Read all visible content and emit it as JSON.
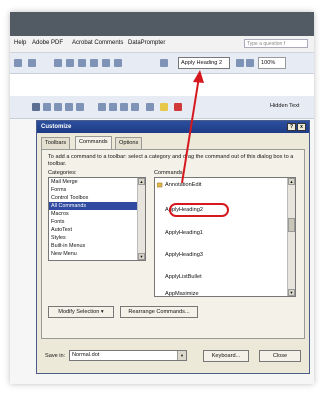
{
  "menubar": {
    "items": [
      "Help",
      "Adobe PDF",
      "Acrobat Comments",
      "DataPrompter"
    ],
    "ask_placeholder": "Type a question f"
  },
  "toolbar": {
    "style_value": "Apply Heading 2",
    "zoom_value": "100%",
    "hidden_text": "Hidden Text"
  },
  "dialog": {
    "title": "Customize",
    "close_glyph": "x",
    "help_glyph": "?",
    "tabs": [
      "Toolbars",
      "Commands",
      "Options"
    ],
    "active_tab": "Commands",
    "instructions": "To add a command to a toolbar: select a category and drag the command out of this dialog box to a toolbar.",
    "categories_label": "Categories:",
    "commands_label": "Commands:",
    "categories": [
      "Mail Merge",
      "Forms",
      "Control Toolbox",
      "All Commands",
      "Macros",
      "Fonts",
      "AutoText",
      "Styles",
      "Built-in Menus",
      "New Menu"
    ],
    "selected_category": "All Commands",
    "commands": [
      "AnnotationEdit",
      "ApplyHeading2",
      "ApplyHeading1",
      "ApplyHeading3",
      "ApplyListBullet",
      "AppMaximize"
    ],
    "highlighted_command": "ApplyHeading2",
    "modify_selection": "Modify Selection",
    "rearrange_commands": "Rearrange Commands...",
    "save_in_label": "Save in:",
    "save_in_value": "Normal.dot",
    "keyboard_button": "Keyboard...",
    "close_button": "Close"
  },
  "colors": {
    "annotation_red": "#d6181f",
    "title_blue": "#1d3b86",
    "selection_blue": "#2f4aa0"
  }
}
